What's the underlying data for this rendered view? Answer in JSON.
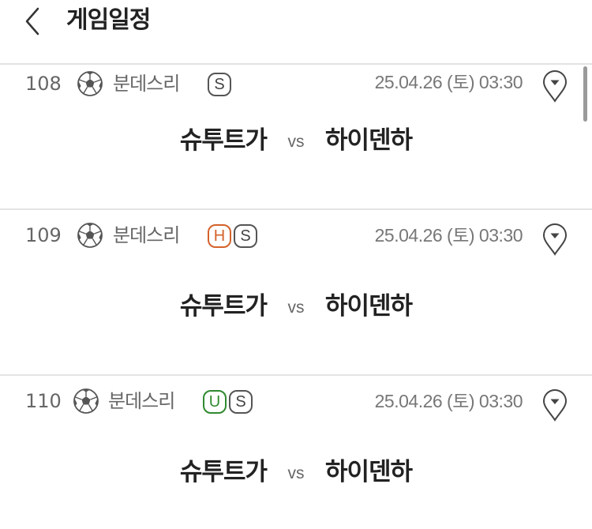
{
  "header": {
    "title": "게임일정"
  },
  "games": [
    {
      "no": "108",
      "league": "분데스리",
      "badges": [
        {
          "label": "S",
          "type": "s"
        }
      ],
      "datetime": "25.04.26 (토) 03:30",
      "home": "슈투트가",
      "vs": "vs",
      "away": "하이덴하"
    },
    {
      "no": "109",
      "league": "분데스리",
      "badges": [
        {
          "label": "H",
          "type": "h"
        },
        {
          "label": "S",
          "type": "s"
        }
      ],
      "datetime": "25.04.26 (토) 03:30",
      "home": "슈투트가",
      "vs": "vs",
      "away": "하이덴하"
    },
    {
      "no": "110",
      "league": "분데스리",
      "badges": [
        {
          "label": "U",
          "type": "u"
        },
        {
          "label": "S",
          "type": "s"
        }
      ],
      "datetime": "25.04.26 (토) 03:30",
      "home": "슈투트가",
      "vs": "vs",
      "away": "하이덴하"
    }
  ],
  "icons": {
    "back": "chevron-left-icon",
    "sport": "soccer-ball-icon",
    "location": "location-pin-icon"
  },
  "colors": {
    "badge_h": "#d4622b",
    "badge_u": "#2f8a2f",
    "badge_s": "#555555"
  }
}
